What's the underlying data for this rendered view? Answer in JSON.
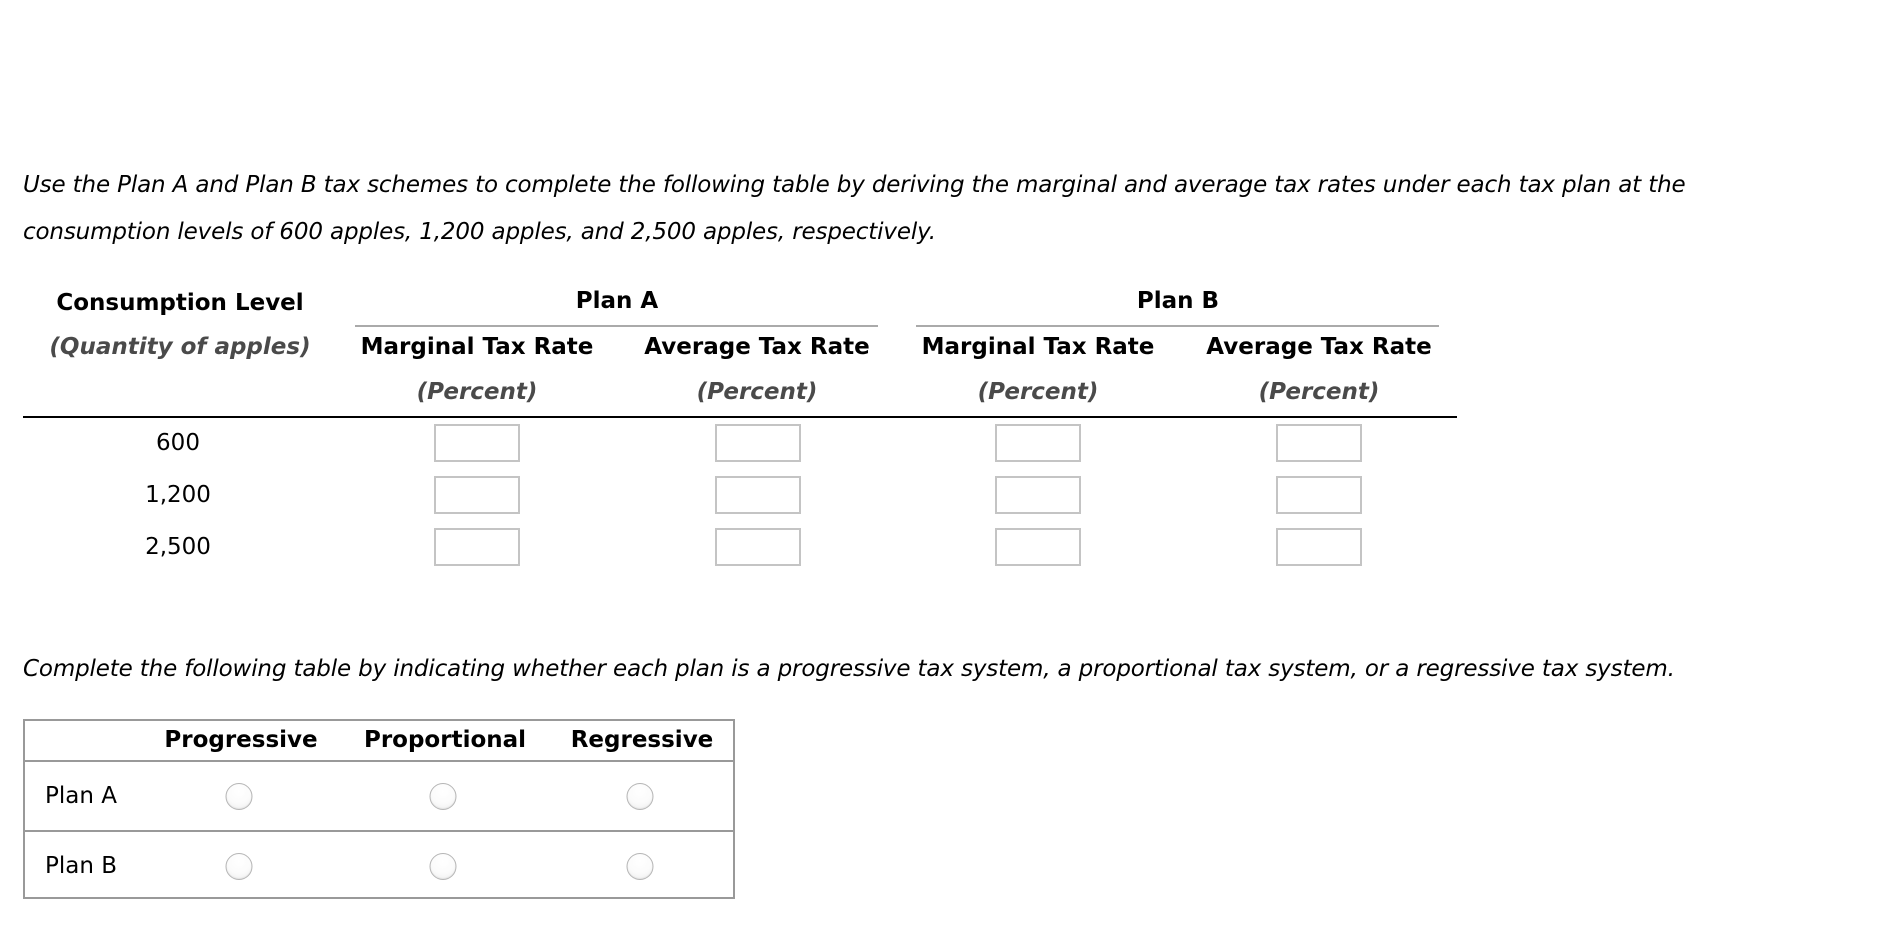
{
  "instructions": {
    "first_line1": "Use the Plan A and Plan B tax schemes to complete the following table by deriving the marginal and average tax rates under each tax plan at the",
    "first_line2": "consumption levels of 600 apples, 1,200 apples, and 2,500 apples, respectively.",
    "second": "Complete the following table by indicating whether each plan is a progressive tax system, a proportional tax system, or a regressive tax system."
  },
  "rates_table": {
    "consumption_header": "Consumption Level",
    "consumption_subheader": "(Quantity of apples)",
    "groups": [
      {
        "name": "Plan A",
        "columns": [
          {
            "label": "Marginal Tax Rate",
            "unit": "(Percent)"
          },
          {
            "label": "Average Tax Rate",
            "unit": "(Percent)"
          }
        ]
      },
      {
        "name": "Plan B",
        "columns": [
          {
            "label": "Marginal Tax Rate",
            "unit": "(Percent)"
          },
          {
            "label": "Average Tax Rate",
            "unit": "(Percent)"
          }
        ]
      }
    ],
    "rows": [
      {
        "quantity": "600",
        "values": [
          "",
          "",
          "",
          ""
        ]
      },
      {
        "quantity": "1,200",
        "values": [
          "",
          "",
          "",
          ""
        ]
      },
      {
        "quantity": "2,500",
        "values": [
          "",
          "",
          "",
          ""
        ]
      }
    ]
  },
  "classification_table": {
    "columns": [
      "Progressive",
      "Proportional",
      "Regressive"
    ],
    "rows": [
      {
        "label": "Plan A",
        "selected": null
      },
      {
        "label": "Plan B",
        "selected": null
      }
    ]
  }
}
